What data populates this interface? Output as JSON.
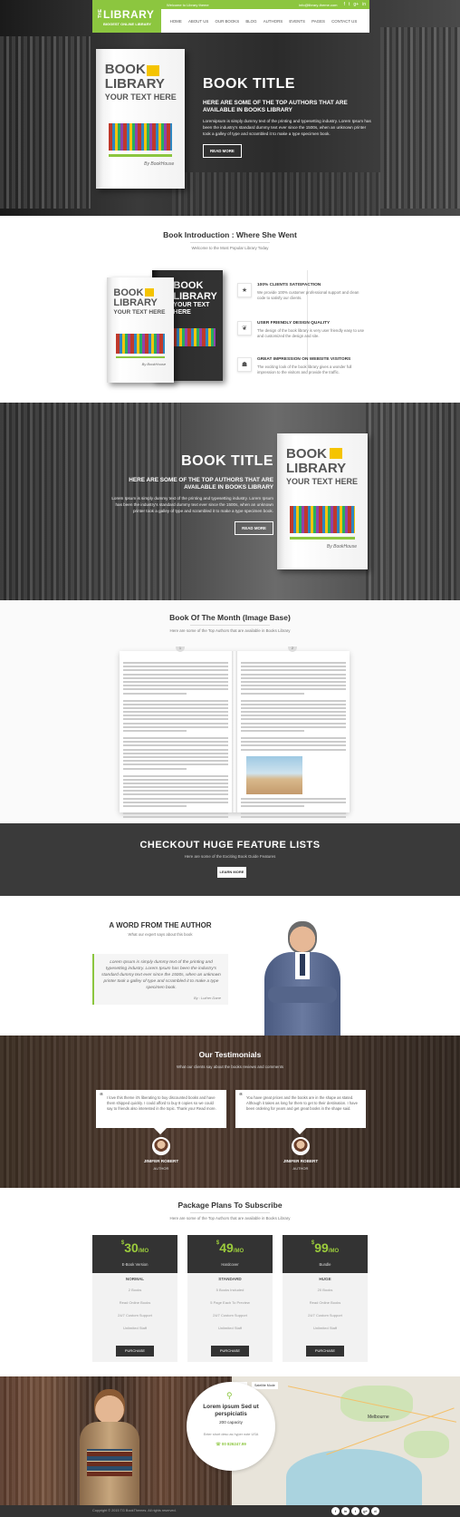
{
  "header": {
    "logo_the": "THE",
    "logo_name": "LIBRARY",
    "logo_tagline": "BIGGEST ONLINE LIBRARY",
    "welcome": "Welcome to Library theme",
    "email": "info@library-theme.com",
    "social": [
      "f",
      "t",
      "g+",
      "in"
    ],
    "nav": [
      "HOME",
      "ABOUT US",
      "OUR BOOKS",
      "BLOG",
      "AUTHORS",
      "EVENTS",
      "PAGES",
      "CONTACT US"
    ]
  },
  "book_cover": {
    "line1": "BOOK",
    "line2": "LIBRARY",
    "line3": "YOUR TEXT HERE",
    "signature": "By BookHouse"
  },
  "hero": {
    "title": "BOOK TITLE",
    "subtitle": "HERE ARE SOME OF THE TOP AUTHORS THAT ARE AVAILABLE IN BOOKS LIBRARY",
    "body": "Loremipsum is simply dummy text of the printing and typesetting industry. Lorem Ipsum has been the industry's standard dummy text ever since the 1500s, when an unknown printer took a galley of type and scrambled it to make a type specimen book.",
    "button": "READ MORE"
  },
  "intro": {
    "title": "Book Introduction : Where She Went",
    "subtitle": "Welcome to the Most Popular Library Today",
    "features": [
      {
        "icon": "star-icon",
        "glyph": "★",
        "title": "100% CLIENTS SATISFACTION",
        "desc": "We provide 100% customer professional support and clean code to satisfy our clients."
      },
      {
        "icon": "leaf-icon",
        "glyph": "❦",
        "title": "USER FRIENDLY DESIGN QUALITY",
        "desc": "The design of the book library is very user friendly easy to use and customized the design and site."
      },
      {
        "icon": "users-icon",
        "glyph": "☗",
        "title": "GREAT IMPRESSION ON WEBSITE VISITORS",
        "desc": "The exciting look of the book library gives a wonder full impression to the visitors and provide the traffic."
      }
    ]
  },
  "hero2": {
    "title": "BOOK TITLE",
    "subtitle": "HERE ARE SOME OF THE TOP AUTHORS THAT ARE AVAILABLE IN BOOKS LIBRARY",
    "body": "Lorem Ipsum is simply dummy text of the printing and typesetting industry. Lorem Ipsum has been the industry's standard dummy text ever since the 1500s, when an unknown printer took a galley of type and scrambled it to make a type specimen book.",
    "button": "READ MORE"
  },
  "bom": {
    "title": "Book Of The Month (Image Base)",
    "subtitle": "Here are some of the Top Authors that are available in Books Library",
    "page_left": "1",
    "page_right": "2"
  },
  "checkout": {
    "title": "CHECKOUT HUGE FEATURE LISTS",
    "subtitle": "Here are some of the Exciting Book Guide Features",
    "button": "LEARN MORE"
  },
  "author": {
    "title": "A WORD FROM THE AUTHOR",
    "subtitle": "What our expert says about this book",
    "quote": "Lorem Ipsum is simply dummy text of the printing and typesetting industry. Lorem Ipsum has been the industry's standard dummy text ever since the 1500s, when an unknown printer took a galley of type and scrambled it to make a type specimen book.",
    "by": "By : Luther Dane"
  },
  "testimonials": {
    "title": "Our Testimonials",
    "subtitle": "What our clients say about the books reviews and comments",
    "items": [
      {
        "text": "I love this theme it's liberating to buy discounted books and have them shipped quickly. I could afford to buy 8 copies so we could say to friends also interested in the topic. Thank you! Read more.",
        "name": "JINIFER ROBERT",
        "role": "AUTHOR"
      },
      {
        "text": "You have great prices and the books are in the shape as stated. Although it takes as long for them to get to their destination. I have been ordering for years and get great books in the shape said.",
        "name": "JINIFER ROBERT",
        "role": "AUTHOR"
      }
    ]
  },
  "pricing": {
    "title": "Package Plans To Subscribe",
    "subtitle": "Here are some of the Top Authors that are available in Books Library",
    "plans": [
      {
        "price": "30",
        "per": "/MO",
        "name": "E-Book Version",
        "level": "NORMAL",
        "items": [
          "2 Books",
          "Read Online Books",
          "24/7 Custom Support",
          "Unlimited Staff"
        ],
        "button": "PURCHASE"
      },
      {
        "price": "49",
        "per": "/MO",
        "name": "Hardcover",
        "level": "STANDARD",
        "items": [
          "5 Books Included",
          "5 Page Each To Preview",
          "24/7 Custom Support",
          "Unlimited Staff"
        ],
        "button": "PURCHASE"
      },
      {
        "price": "99",
        "per": "/MO",
        "name": "Bundle",
        "level": "HUGE",
        "items": [
          "20 Books",
          "Read Online Books",
          "24/7 Custom Support",
          "Unlimited Staff"
        ],
        "button": "PURCHASE"
      }
    ]
  },
  "contact": {
    "title": "Lorem ipsum Sed ut perspiciatis",
    "capacity": "200 capacity",
    "address": "Enter short desc as hyper note USA",
    "phone": "☏ 00 826247.99",
    "map_tabs": [
      "Map",
      "Satellite Mode"
    ],
    "map_city": "Melbourne"
  },
  "footer": {
    "copyright": "Copyright © 2015 TG BookThemes. All rights reserved.",
    "social": [
      "f",
      "in",
      "t",
      "g+",
      "d"
    ]
  },
  "colors": {
    "accent": "#8cc63f",
    "dark": "#333333",
    "price": "#9ccc3c"
  }
}
